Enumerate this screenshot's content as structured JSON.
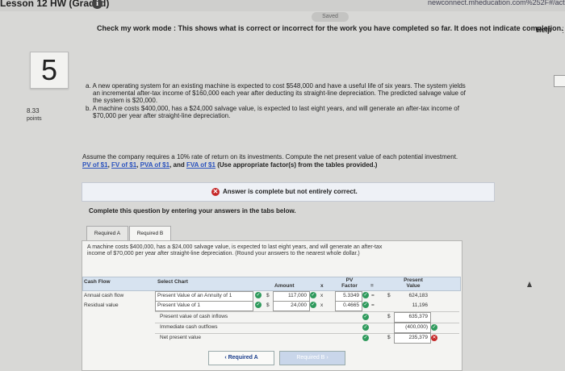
{
  "header": {
    "lesson_title": "Lesson 12 HW (Graded)",
    "url": "newconnect.mheducation.com%252F#/activity/c",
    "saved": "Saved",
    "help": "Help",
    "check_mode": "Check my work mode : This shows what is correct or incorrect for the work you have completed so far. It does not indicate completion."
  },
  "question": {
    "number": "5",
    "points_value": "8.33",
    "points_label": "points",
    "part_a_line1": "a. A new operating system for an existing machine is expected to cost $548,000 and have a useful life of six years. The system yields",
    "part_a_line2": "an incremental after-tax income of $160,000 each year after deducting its straight-line depreciation. The predicted salvage value of",
    "part_a_line3": "the system is $20,000.",
    "part_b_line1": "b. A machine costs $400,000, has a $24,000 salvage value, is expected to last eight years, and will generate an after-tax income of",
    "part_b_line2": "$70,000 per year after straight-line depreciation.",
    "assume_text": "Assume the company requires a 10% rate of return on its investments. Compute the net present value of each potential investment.",
    "links": [
      "PV of $1",
      "FV of $1",
      "PVA of $1",
      "FVA of $1"
    ],
    "links_note": "(Use appropriate factor(s) from the tables provided.)"
  },
  "banner": {
    "text": "Answer is complete but not entirely correct."
  },
  "instructions": "Complete this question by entering your answers in the tabs below.",
  "tabs": [
    {
      "label": "Required A"
    },
    {
      "label": "Required B"
    }
  ],
  "panel": {
    "text_line1": "A machine costs $400,000, has a $24,000 salvage value, is expected to last eight years, and will generate an after-tax",
    "text_line2": "income of $70,000 per year after straight-line depreciation. (Round your answers to the nearest whole dollar.)",
    "headers": {
      "cash_flow": "Cash Flow",
      "select_chart": "Select Chart",
      "amount": "Amount",
      "times": "x",
      "pv_factor": "PV Factor",
      "equals": "=",
      "present_value": "Present Value"
    },
    "rows": [
      {
        "cash_flow": "Annual cash flow",
        "chart": "Present Value of an Annuity of 1",
        "dollar": "$",
        "amount": "117,000",
        "times": "x",
        "factor": "5.3349",
        "eq": "=",
        "dollar2": "$",
        "pv": "624,183"
      },
      {
        "cash_flow": "Residual value",
        "chart": "Present Value of 1",
        "dollar": "$",
        "amount": "24,000",
        "times": "x",
        "factor": "0.4665",
        "eq": "=",
        "dollar2": "",
        "pv": "11,196"
      }
    ],
    "summary": [
      {
        "label": "Present value of cash inflows",
        "dollar": "$",
        "value": "635,379"
      },
      {
        "label": "Immediate cash outflows",
        "dollar": "",
        "value": "(400,000)"
      },
      {
        "label": "Net present value",
        "dollar": "$",
        "value": "235,379"
      }
    ]
  },
  "nav": {
    "prev_label": "Required A",
    "next_label": "Required B"
  },
  "colors": {
    "correct": "#2e9a5c",
    "incorrect": "#c62828",
    "link": "#2a52be"
  }
}
